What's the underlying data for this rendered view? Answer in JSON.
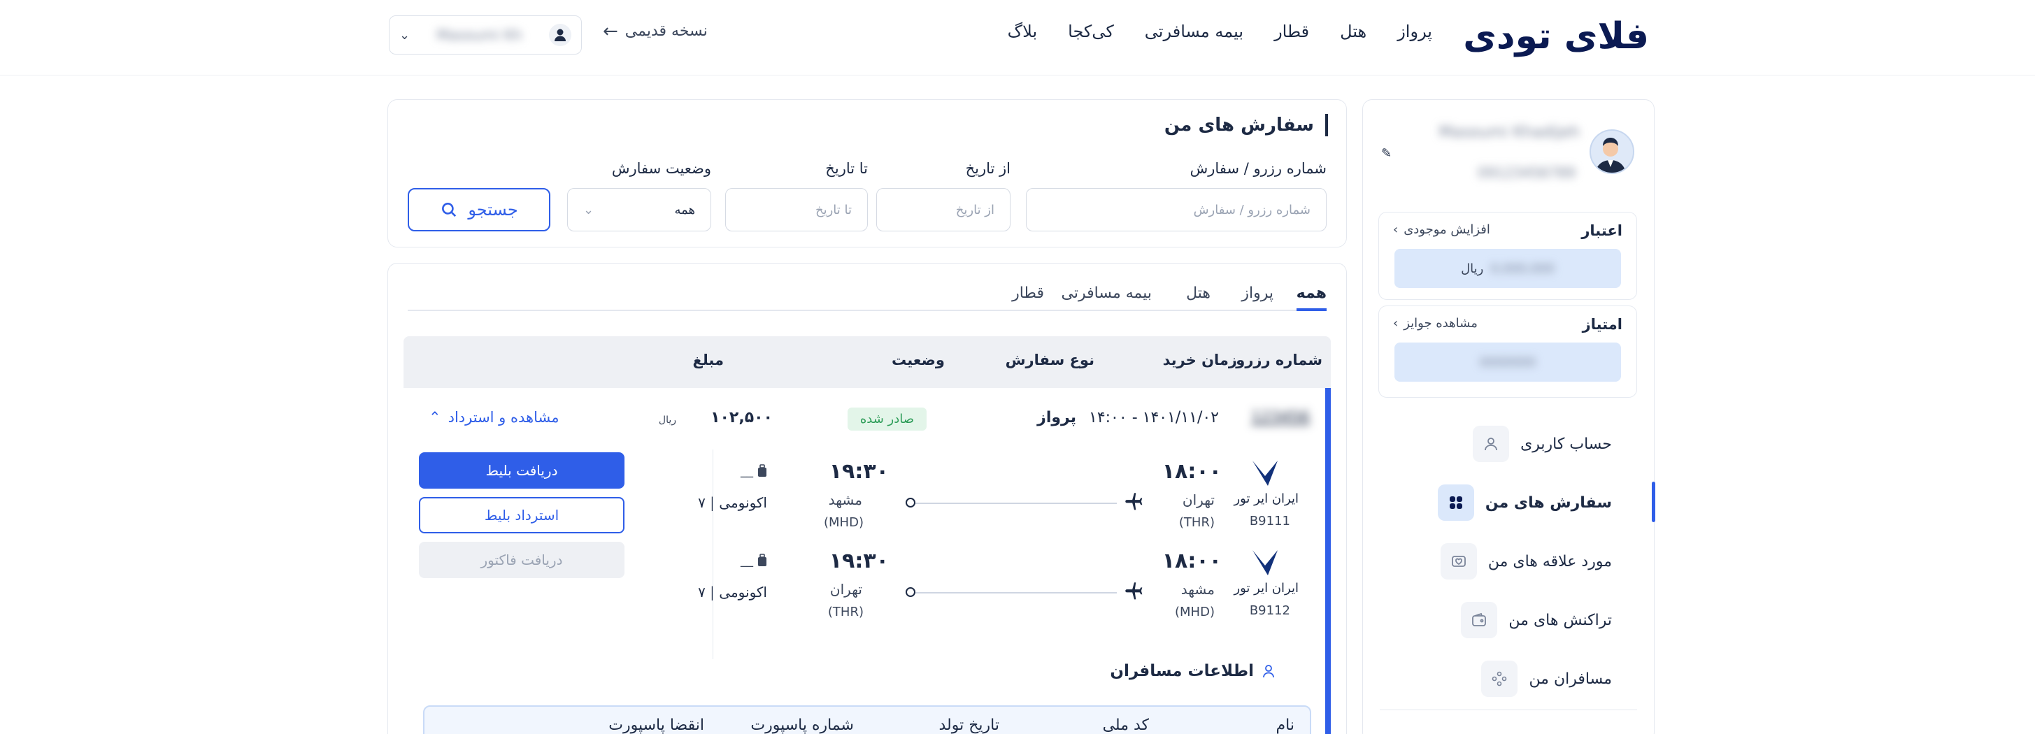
{
  "header": {
    "logo": "فلای تودی",
    "nav": [
      "پرواز",
      "هتل",
      "قطار",
      "بیمه مسافرتی",
      "کی‌کجا",
      "بلاگ"
    ],
    "old_version": "نسخه قدیمی",
    "user_name": "Masoumi Kh"
  },
  "sidebar": {
    "profile_name": "Masoumi Khadijeh",
    "profile_phone": "09123456789",
    "credit": {
      "title": "اعتبار",
      "link": "افزایش موجودی",
      "value": "0,000,000",
      "unit": "ریال"
    },
    "points": {
      "title": "امتیاز",
      "link": "مشاهده جوایز",
      "value": "0000000"
    },
    "menu": [
      {
        "label": "حساب کاربری",
        "icon": "user-icon"
      },
      {
        "label": "سفارش های من",
        "icon": "orders-icon"
      },
      {
        "label": "مورد علاقه های من",
        "icon": "favorites-icon"
      },
      {
        "label": "تراکنش های من",
        "icon": "wallet-icon"
      },
      {
        "label": "مسافران من",
        "icon": "passengers-icon"
      }
    ]
  },
  "filter": {
    "title": "سفارش های من",
    "order_label": "شماره رزرو / سفارش",
    "order_placeholder": "شماره رزرو / سفارش",
    "from_label": "از تاریخ",
    "from_placeholder": "از تاریخ",
    "to_label": "تا تاریخ",
    "to_placeholder": "تا تاریخ",
    "status_label": "وضعیت سفارش",
    "status_value": "همه",
    "search_button": "جستجو"
  },
  "orders": {
    "tabs": [
      "همه",
      "پرواز",
      "هتل",
      "بیمه مسافرتی",
      "قطار"
    ],
    "columns": [
      "شماره رزرو",
      "زمان خرید",
      "نوع سفارش",
      "وضعیت",
      "مبلغ"
    ],
    "order": {
      "reservation_no": "123456",
      "purchase_time": "۱۴۰۱/۱۱/۰۲ - ۱۴:۰۰",
      "type": "پرواز",
      "status": "صادر شده",
      "amount": "۱۰۲,۵۰۰",
      "currency": "ریال",
      "toggle": "مشاهده و استرداد",
      "flights": [
        {
          "airline": "ایران ایر تور",
          "flight_no": "B9111",
          "dep_time": "۱۸:۰۰",
          "dep_city": "تهران",
          "dep_code": "(THR)",
          "arr_time": "۱۹:۳۰",
          "arr_city": "مشهد",
          "arr_code": "(MHD)",
          "baggage": "__",
          "cabin": "اکونومی | ۷"
        },
        {
          "airline": "ایران ایر تور",
          "flight_no": "B9112",
          "dep_time": "۱۸:۰۰",
          "dep_city": "مشهد",
          "dep_code": "(MHD)",
          "arr_time": "۱۹:۳۰",
          "arr_city": "تهران",
          "arr_code": "(THR)",
          "baggage": "__",
          "cabin": "اکونومی | ۷"
        }
      ],
      "buttons": {
        "get_ticket": "دریافت بلیط",
        "refund": "استرداد بلیط",
        "invoice": "دریافت فاکتور"
      }
    },
    "passengers": {
      "title": "اطلاعات مسافران",
      "columns": [
        "نام",
        "کد ملی",
        "تاریخ تولد",
        "شماره پاسپورت",
        "انقضا پاسپورت"
      ]
    }
  },
  "colors": {
    "primary": "#2f5ee8",
    "navy": "#0b1a52",
    "success": "#2c9c57"
  }
}
